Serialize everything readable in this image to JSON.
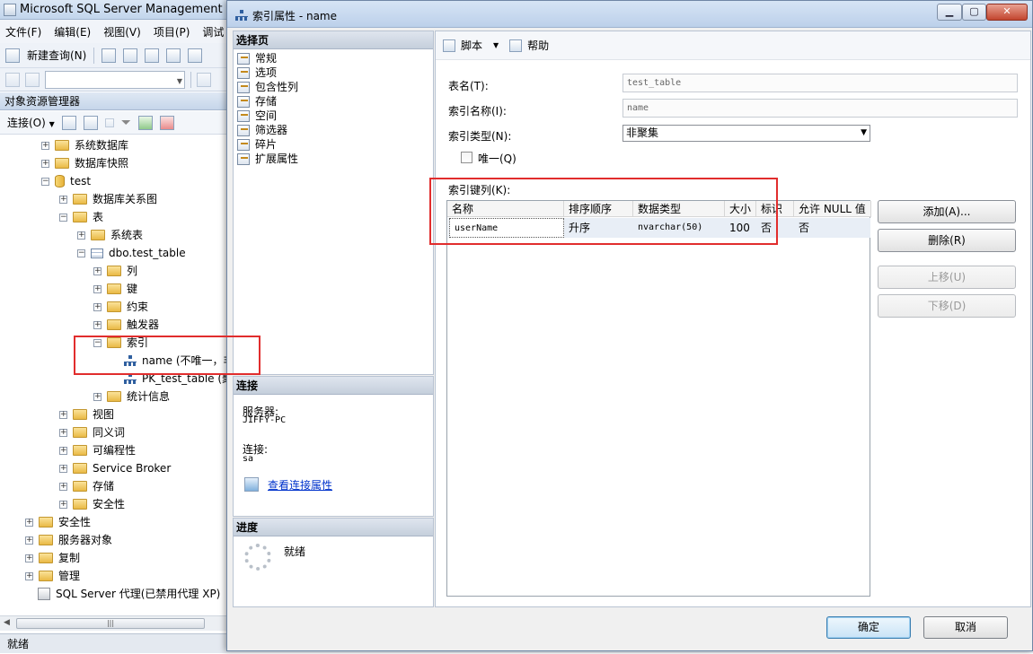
{
  "main_window": {
    "title": "Microsoft SQL Server Management Studio",
    "menu": [
      "文件(F)",
      "编辑(E)",
      "视图(V)",
      "项目(P)",
      "调试"
    ],
    "toolbar": {
      "new_query_label": "新建查询(N)"
    },
    "object_explorer": {
      "title": "对象资源管理器",
      "connect_label": "连接(O)",
      "tree": [
        {
          "label": "系统数据库",
          "expander": "+",
          "icon": "folder"
        },
        {
          "label": "数据库快照",
          "expander": "+",
          "icon": "folder"
        },
        {
          "label": "test",
          "expander": "−",
          "icon": "database"
        },
        {
          "label": "数据库关系图",
          "expander": "+",
          "icon": "folder"
        },
        {
          "label": "表",
          "expander": "−",
          "icon": "folder"
        },
        {
          "label": "系统表",
          "expander": "+",
          "icon": "folder"
        },
        {
          "label": "dbo.test_table",
          "expander": "−",
          "icon": "table"
        },
        {
          "label": "列",
          "expander": "+",
          "icon": "folder"
        },
        {
          "label": "键",
          "expander": "+",
          "icon": "folder"
        },
        {
          "label": "约束",
          "expander": "+",
          "icon": "folder"
        },
        {
          "label": "触发器",
          "expander": "+",
          "icon": "folder"
        },
        {
          "label": "索引",
          "expander": "−",
          "icon": "folder"
        },
        {
          "label": "name (不唯一，非",
          "expander": "",
          "icon": "index"
        },
        {
          "label": "PK_test_table (聚",
          "expander": "",
          "icon": "index"
        },
        {
          "label": "统计信息",
          "expander": "+",
          "icon": "folder"
        },
        {
          "label": "视图",
          "expander": "+",
          "icon": "folder"
        },
        {
          "label": "同义词",
          "expander": "+",
          "icon": "folder"
        },
        {
          "label": "可编程性",
          "expander": "+",
          "icon": "folder"
        },
        {
          "label": "Service Broker",
          "expander": "+",
          "icon": "folder"
        },
        {
          "label": "存储",
          "expander": "+",
          "icon": "folder"
        },
        {
          "label": "安全性",
          "expander": "+",
          "icon": "folder"
        },
        {
          "label": "安全性",
          "expander": "+",
          "icon": "folder"
        },
        {
          "label": "服务器对象",
          "expander": "+",
          "icon": "folder"
        },
        {
          "label": "复制",
          "expander": "+",
          "icon": "folder"
        },
        {
          "label": "管理",
          "expander": "+",
          "icon": "folder"
        },
        {
          "label": "SQL Server 代理(已禁用代理 XP)",
          "expander": "",
          "icon": "agent"
        }
      ]
    },
    "status_text": "就绪"
  },
  "dialog": {
    "title": "索引属性 - name",
    "select_page": {
      "header": "选择页",
      "items": [
        "常规",
        "选项",
        "包含性列",
        "存储",
        "空间",
        "筛选器",
        "碎片",
        "扩展属性"
      ]
    },
    "connection": {
      "header": "连接",
      "server_label": "服务器:",
      "server_value": "JIFFY-PC",
      "connection_label": "连接:",
      "connection_value": "sa",
      "view_link": "查看连接属性"
    },
    "progress": {
      "header": "进度",
      "status": "就绪"
    },
    "toolbar": {
      "script_label": "脚本",
      "help_label": "帮助"
    },
    "form": {
      "table_name_label": "表名(T):",
      "table_name_value": "test_table",
      "index_name_label": "索引名称(I):",
      "index_name_value": "name",
      "index_type_label": "索引类型(N):",
      "index_type_value": "非聚集",
      "unique_label": "唯一(Q)",
      "key_columns_label": "索引键列(K):"
    },
    "grid": {
      "columns": [
        "名称",
        "排序顺序",
        "数据类型",
        "大小",
        "标识",
        "允许 NULL 值"
      ],
      "rows": [
        [
          "userName",
          "升序",
          "nvarchar(50)",
          "100",
          "否",
          "否"
        ]
      ]
    },
    "side_buttons": {
      "add": "添加(A)...",
      "remove": "删除(R)",
      "move_up": "上移(U)",
      "move_down": "下移(D)"
    },
    "footer": {
      "ok": "确定",
      "cancel": "取消"
    }
  },
  "colors": {
    "highlight": "#e12d2d",
    "link": "#0033cc"
  }
}
